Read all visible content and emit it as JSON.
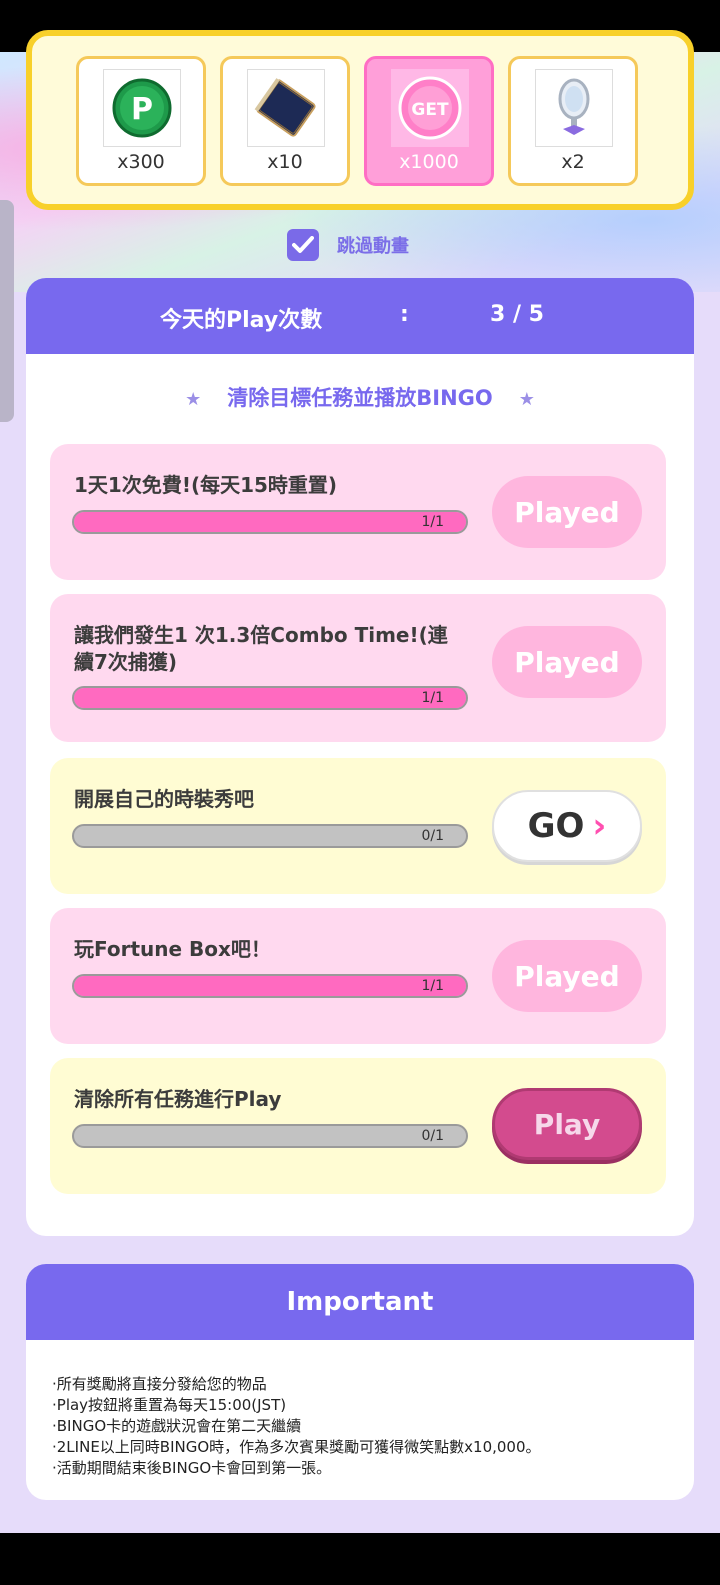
{
  "rewards": [
    {
      "icon": "p-coin-icon",
      "qty": "x300",
      "selected": false
    },
    {
      "icon": "book-icon",
      "qty": "x10",
      "selected": false
    },
    {
      "icon": "get-badge-icon",
      "qty": "x1000",
      "selected": true,
      "badge": "GET"
    },
    {
      "icon": "hand-mirror-icon",
      "qty": "x2",
      "selected": false
    }
  ],
  "skip": {
    "label": "跳過動畫",
    "checked": true
  },
  "header": {
    "label": "今天的Play次數",
    "colon": ":",
    "count": "3 / 5"
  },
  "subtitle": "清除目標任務並播放BINGO",
  "missions": [
    {
      "text": "1天1次免費!(每天15時重置)",
      "progress": "1/1",
      "progress_value": 1,
      "button": "Played",
      "type": "played"
    },
    {
      "text": "讓我們發生1 次1.3倍Combo Time!(連續7次捕獲)",
      "progress": "1/1",
      "progress_value": 1,
      "button": "Played",
      "type": "played"
    },
    {
      "text": "開展自己的時裝秀吧",
      "progress": "0/1",
      "progress_value": 0,
      "button": "GO",
      "type": "go"
    },
    {
      "text": "玩Fortune Box吧！",
      "progress": "1/1",
      "progress_value": 1,
      "button": "Played",
      "type": "played"
    },
    {
      "text": "清除所有任務進行Play",
      "progress": "0/1",
      "progress_value": 0,
      "button": "Play",
      "type": "play"
    }
  ],
  "important": {
    "title": "Important",
    "items": [
      "·所有獎勵將直接分發給您的物品",
      "·Play按鈕將重置為每天15:00(JST)",
      "·BINGO卡的遊戲狀況會在第二天繼續",
      "·2LINE以上同時BINGO時，作為多次賓果獎勵可獲得微笑點數x10,000。",
      "·活動期間結束後BINGO卡會回到第一張。"
    ]
  },
  "colors": {
    "accent": "#7869ee",
    "pink": "#ff6ac0",
    "gold": "#f8d02a"
  }
}
